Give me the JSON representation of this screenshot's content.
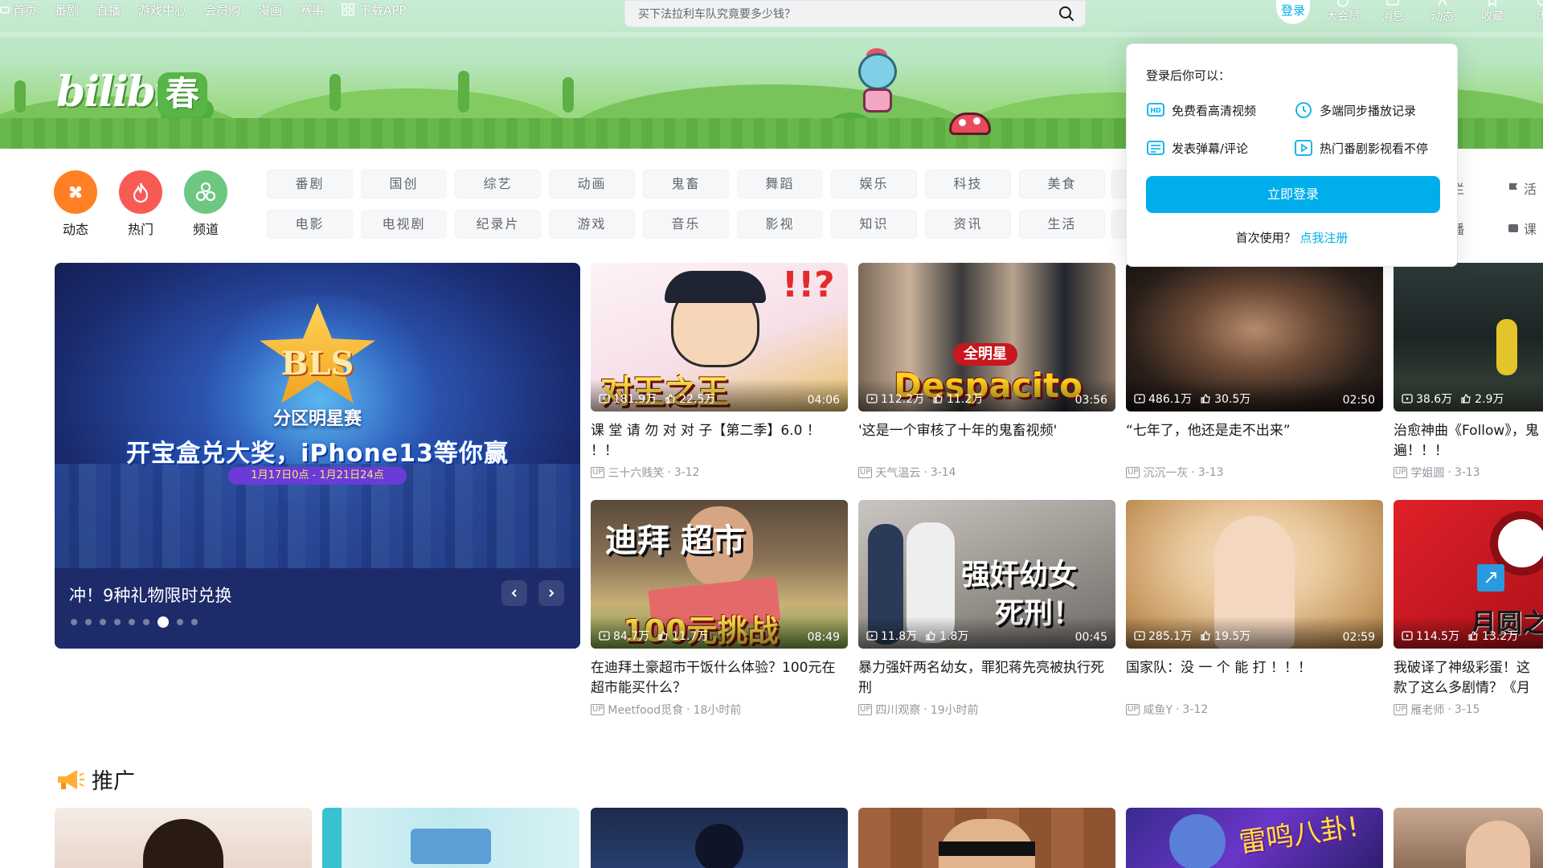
{
  "topnav": {
    "items": [
      "首页",
      "番剧",
      "直播",
      "游戏中心",
      "会员购",
      "漫画",
      "赛事"
    ],
    "download": "下载APP"
  },
  "search": {
    "placeholder": "买下法拉利车队究竟要多少钱？"
  },
  "user": {
    "login_avatar": "登录"
  },
  "right_nav": [
    "大会员",
    "消息",
    "动态",
    "收藏",
    "历"
  ],
  "banner": {
    "logo_text": "bilibili",
    "logo_badge": "春"
  },
  "quick_links": [
    {
      "label": "动态",
      "color": "#ff7f24"
    },
    {
      "label": "热门",
      "color": "#f85a54"
    },
    {
      "label": "频道",
      "color": "#6dc781"
    }
  ],
  "channels_row1": [
    "番剧",
    "国创",
    "综艺",
    "动画",
    "鬼畜",
    "舞蹈",
    "娱乐",
    "科技",
    "美食"
  ],
  "channels_row2": [
    "电影",
    "电视剧",
    "纪录片",
    "游戏",
    "音乐",
    "影视",
    "知识",
    "资讯",
    "生活"
  ],
  "side_links": {
    "column_col": "专栏",
    "activity": "活",
    "live": "直播",
    "course": "课"
  },
  "carousel": {
    "logo": "BLS",
    "subtitle": "分区明星赛",
    "headline": "开宝盒兑大奖，iPhone13等你赢",
    "date": "1月17日0点 - 1月21日24点",
    "caption": "冲！9种礼物限时兑换",
    "dot_count": 9,
    "active_dot": 6
  },
  "videos": [
    {
      "thumb_text": "对王之王",
      "plays": "181.9万",
      "likes": "22.5万",
      "duration": "04:06",
      "title": "课 堂 请 勿 对 对 子【第二季】6.0 ！ ！！",
      "author": "三十六贱笑",
      "date": "3-12"
    },
    {
      "thumb_text": "Despacito",
      "plays": "112.2万",
      "likes": "11.2万",
      "duration": "03:56",
      "title": "'这是一个审核了十年的鬼畜视频'",
      "author": "天气温云",
      "date": "3-14"
    },
    {
      "thumb_text": "",
      "plays": "486.1万",
      "likes": "30.5万",
      "duration": "02:50",
      "title": "“七年了，他还是走不出来”",
      "author": "沉沉一灰",
      "date": "3-13"
    },
    {
      "thumb_text": "",
      "plays": "38.6万",
      "likes": "2.9万",
      "duration": "",
      "title": "治愈神曲《Follow》，鬼 遍！！！",
      "author": "学姐圆",
      "date": "3-13"
    },
    {
      "thumb_text": "迪拜  超市",
      "thumb_text2": "100元挑战",
      "plays": "84.7万",
      "likes": "11.7万",
      "duration": "08:49",
      "title": "在迪拜土豪超市干饭什么体验？100元在超市能买什么？",
      "author": "Meetfood觅食",
      "date": "18小时前"
    },
    {
      "thumb_text": "强奸幼女",
      "thumb_text2": "死刑！",
      "plays": "11.8万",
      "likes": "1.8万",
      "duration": "00:45",
      "title": "暴力强奸两名幼女，罪犯蒋先亮被执行死刑",
      "author": "四川观察",
      "date": "19小时前"
    },
    {
      "thumb_text": "",
      "plays": "285.1万",
      "likes": "19.5万",
      "duration": "02:59",
      "title": "国家队：没 一 个 能 打 ！！！",
      "author": "咸鱼Y",
      "date": "3-12"
    },
    {
      "thumb_text": "月圆之",
      "plays": "114.5万",
      "likes": "13.2万",
      "duration": "",
      "title": "我破译了神级彩蛋！这款了这么多剧情？《月圆之",
      "author": "雁老师",
      "date": "3-15"
    }
  ],
  "login_popover": {
    "title": "登录后你可以：",
    "features": [
      "免费看高清视频",
      "多端同步播放记录",
      "发表弹幕/评论",
      "热门番剧影视看不停"
    ],
    "button": "立即登录",
    "first_use": "首次使用？",
    "register": "点我注册"
  },
  "promo": {
    "title": "推广",
    "card5_text": "雷鸣八卦!"
  },
  "colors": {
    "accent": "#00aeec",
    "text": "#18191c",
    "muted": "#9499a0"
  }
}
